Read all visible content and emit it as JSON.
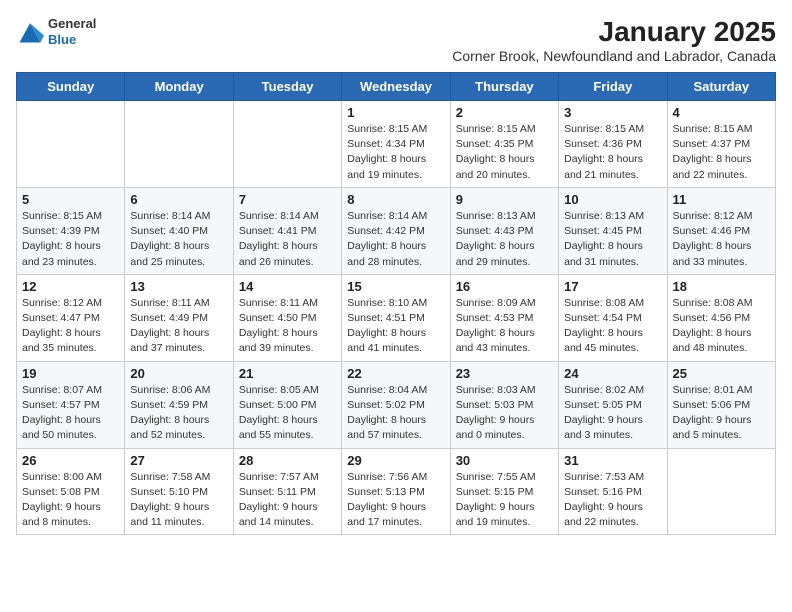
{
  "header": {
    "logo": {
      "general": "General",
      "blue": "Blue"
    },
    "title": "January 2025",
    "subtitle": "Corner Brook, Newfoundland and Labrador, Canada"
  },
  "weekdays": [
    "Sunday",
    "Monday",
    "Tuesday",
    "Wednesday",
    "Thursday",
    "Friday",
    "Saturday"
  ],
  "weeks": [
    [
      {
        "day": "",
        "info": ""
      },
      {
        "day": "",
        "info": ""
      },
      {
        "day": "",
        "info": ""
      },
      {
        "day": "1",
        "info": "Sunrise: 8:15 AM\nSunset: 4:34 PM\nDaylight: 8 hours\nand 19 minutes."
      },
      {
        "day": "2",
        "info": "Sunrise: 8:15 AM\nSunset: 4:35 PM\nDaylight: 8 hours\nand 20 minutes."
      },
      {
        "day": "3",
        "info": "Sunrise: 8:15 AM\nSunset: 4:36 PM\nDaylight: 8 hours\nand 21 minutes."
      },
      {
        "day": "4",
        "info": "Sunrise: 8:15 AM\nSunset: 4:37 PM\nDaylight: 8 hours\nand 22 minutes."
      }
    ],
    [
      {
        "day": "5",
        "info": "Sunrise: 8:15 AM\nSunset: 4:39 PM\nDaylight: 8 hours\nand 23 minutes."
      },
      {
        "day": "6",
        "info": "Sunrise: 8:14 AM\nSunset: 4:40 PM\nDaylight: 8 hours\nand 25 minutes."
      },
      {
        "day": "7",
        "info": "Sunrise: 8:14 AM\nSunset: 4:41 PM\nDaylight: 8 hours\nand 26 minutes."
      },
      {
        "day": "8",
        "info": "Sunrise: 8:14 AM\nSunset: 4:42 PM\nDaylight: 8 hours\nand 28 minutes."
      },
      {
        "day": "9",
        "info": "Sunrise: 8:13 AM\nSunset: 4:43 PM\nDaylight: 8 hours\nand 29 minutes."
      },
      {
        "day": "10",
        "info": "Sunrise: 8:13 AM\nSunset: 4:45 PM\nDaylight: 8 hours\nand 31 minutes."
      },
      {
        "day": "11",
        "info": "Sunrise: 8:12 AM\nSunset: 4:46 PM\nDaylight: 8 hours\nand 33 minutes."
      }
    ],
    [
      {
        "day": "12",
        "info": "Sunrise: 8:12 AM\nSunset: 4:47 PM\nDaylight: 8 hours\nand 35 minutes."
      },
      {
        "day": "13",
        "info": "Sunrise: 8:11 AM\nSunset: 4:49 PM\nDaylight: 8 hours\nand 37 minutes."
      },
      {
        "day": "14",
        "info": "Sunrise: 8:11 AM\nSunset: 4:50 PM\nDaylight: 8 hours\nand 39 minutes."
      },
      {
        "day": "15",
        "info": "Sunrise: 8:10 AM\nSunset: 4:51 PM\nDaylight: 8 hours\nand 41 minutes."
      },
      {
        "day": "16",
        "info": "Sunrise: 8:09 AM\nSunset: 4:53 PM\nDaylight: 8 hours\nand 43 minutes."
      },
      {
        "day": "17",
        "info": "Sunrise: 8:08 AM\nSunset: 4:54 PM\nDaylight: 8 hours\nand 45 minutes."
      },
      {
        "day": "18",
        "info": "Sunrise: 8:08 AM\nSunset: 4:56 PM\nDaylight: 8 hours\nand 48 minutes."
      }
    ],
    [
      {
        "day": "19",
        "info": "Sunrise: 8:07 AM\nSunset: 4:57 PM\nDaylight: 8 hours\nand 50 minutes."
      },
      {
        "day": "20",
        "info": "Sunrise: 8:06 AM\nSunset: 4:59 PM\nDaylight: 8 hours\nand 52 minutes."
      },
      {
        "day": "21",
        "info": "Sunrise: 8:05 AM\nSunset: 5:00 PM\nDaylight: 8 hours\nand 55 minutes."
      },
      {
        "day": "22",
        "info": "Sunrise: 8:04 AM\nSunset: 5:02 PM\nDaylight: 8 hours\nand 57 minutes."
      },
      {
        "day": "23",
        "info": "Sunrise: 8:03 AM\nSunset: 5:03 PM\nDaylight: 9 hours\nand 0 minutes."
      },
      {
        "day": "24",
        "info": "Sunrise: 8:02 AM\nSunset: 5:05 PM\nDaylight: 9 hours\nand 3 minutes."
      },
      {
        "day": "25",
        "info": "Sunrise: 8:01 AM\nSunset: 5:06 PM\nDaylight: 9 hours\nand 5 minutes."
      }
    ],
    [
      {
        "day": "26",
        "info": "Sunrise: 8:00 AM\nSunset: 5:08 PM\nDaylight: 9 hours\nand 8 minutes."
      },
      {
        "day": "27",
        "info": "Sunrise: 7:58 AM\nSunset: 5:10 PM\nDaylight: 9 hours\nand 11 minutes."
      },
      {
        "day": "28",
        "info": "Sunrise: 7:57 AM\nSunset: 5:11 PM\nDaylight: 9 hours\nand 14 minutes."
      },
      {
        "day": "29",
        "info": "Sunrise: 7:56 AM\nSunset: 5:13 PM\nDaylight: 9 hours\nand 17 minutes."
      },
      {
        "day": "30",
        "info": "Sunrise: 7:55 AM\nSunset: 5:15 PM\nDaylight: 9 hours\nand 19 minutes."
      },
      {
        "day": "31",
        "info": "Sunrise: 7:53 AM\nSunset: 5:16 PM\nDaylight: 9 hours\nand 22 minutes."
      },
      {
        "day": "",
        "info": ""
      }
    ]
  ]
}
